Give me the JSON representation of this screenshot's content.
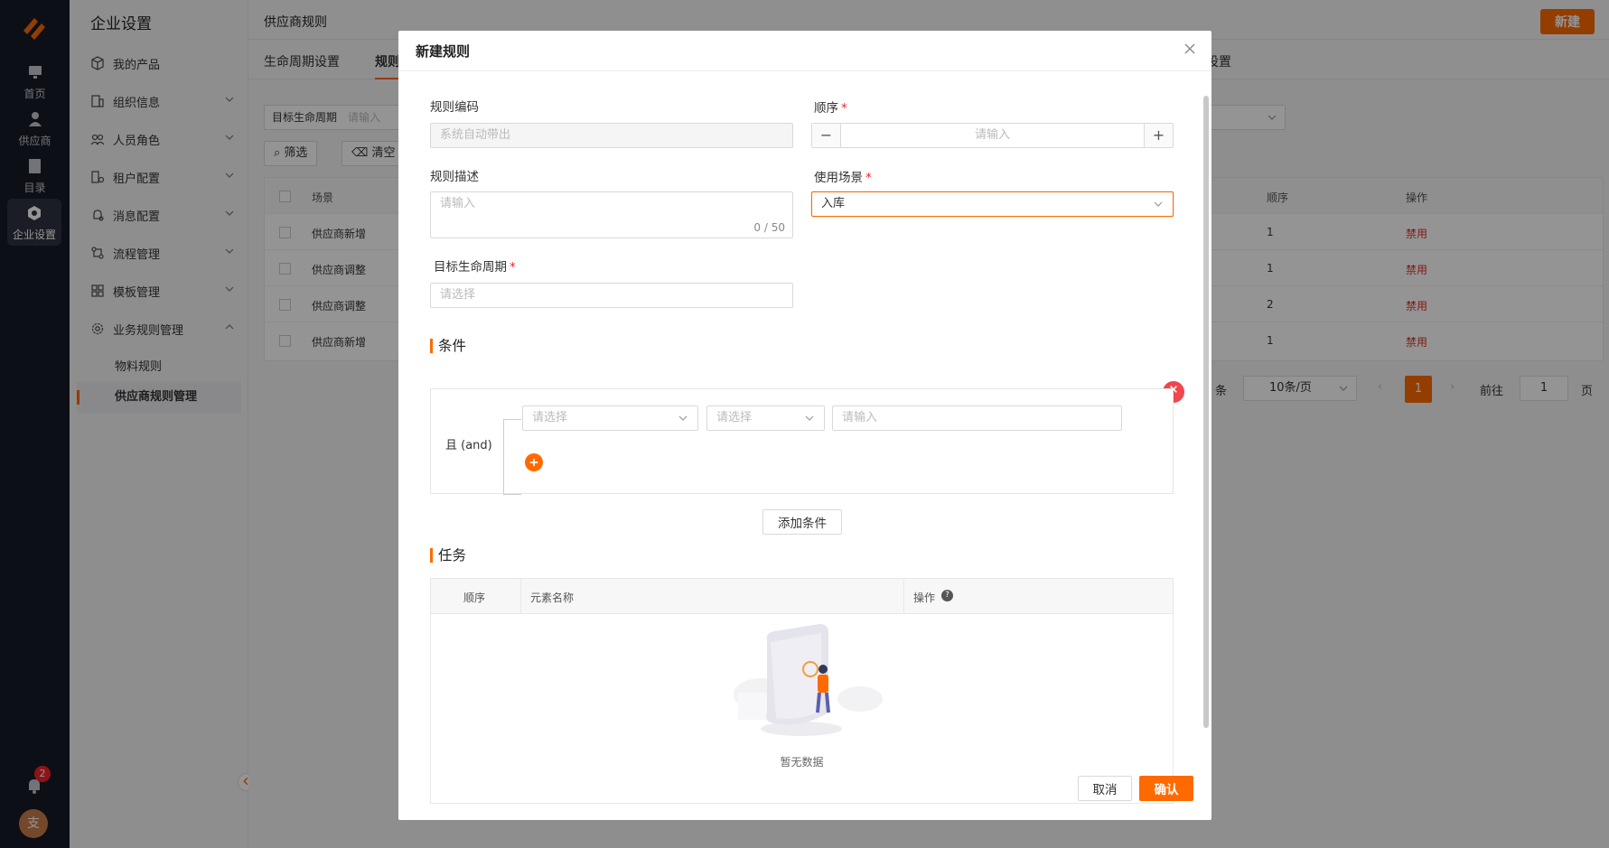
{
  "rail": {
    "items": [
      {
        "label": "首页"
      },
      {
        "label": "供应商"
      },
      {
        "label": "目录"
      },
      {
        "label": "企业设置"
      }
    ],
    "notification_count": "2",
    "avatar_text": "支"
  },
  "sidebar": {
    "title": "企业设置",
    "items": [
      {
        "label": "我的产品"
      },
      {
        "label": "组织信息"
      },
      {
        "label": "人员角色"
      },
      {
        "label": "租户配置"
      },
      {
        "label": "消息配置"
      },
      {
        "label": "流程管理"
      },
      {
        "label": "模板管理"
      },
      {
        "label": "业务规则管理"
      }
    ],
    "sub_items": [
      {
        "label": "物料规则"
      },
      {
        "label": "供应商规则管理"
      }
    ]
  },
  "main": {
    "page_title": "供应商规则",
    "new_button": "新建",
    "tabs": [
      {
        "label": "生命周期设置"
      },
      {
        "label": "规则"
      },
      {
        "label": "设置"
      }
    ],
    "filter_label": "目标生命周期",
    "filter_placeholder": "请输入",
    "filter_button": "筛选",
    "clear_button": "清空",
    "table": {
      "headers": {
        "scene": "场景",
        "order": "顺序",
        "action": "操作"
      },
      "rows": [
        {
          "scene": "供应商新增",
          "order": "1",
          "action": "禁用"
        },
        {
          "scene": "供应商调整",
          "order": "1",
          "action": "禁用"
        },
        {
          "scene": "供应商调整",
          "order": "2",
          "action": "禁用"
        },
        {
          "scene": "供应商新增",
          "order": "1",
          "action": "禁用"
        }
      ]
    },
    "pagination": {
      "total_suffix": "条",
      "page_size": "10条/页",
      "current_page": "1",
      "goto_label": "前往",
      "goto_value": "1",
      "page_suffix": "页"
    }
  },
  "modal": {
    "title": "新建规则",
    "code_label": "规则编码",
    "code_placeholder": "系统自动带出",
    "order_label": "顺序",
    "order_placeholder": "请输入",
    "desc_label": "规则描述",
    "desc_placeholder": "请输入",
    "desc_counter": "0 / 50",
    "scene_label": "使用场景",
    "scene_value": "入库",
    "lifecycle_label": "目标生命周期",
    "lifecycle_placeholder": "请选择",
    "conditions_title": "条件",
    "and_label": "且 (and)",
    "cond_select1_placeholder": "请选择",
    "cond_select2_placeholder": "请选择",
    "cond_input_placeholder": "请输入",
    "add_condition_button": "添加条件",
    "tasks_title": "任务",
    "task_table": {
      "headers": {
        "order": "顺序",
        "name": "元素名称",
        "action": "操作"
      },
      "empty_text": "暂无数据"
    },
    "cancel_button": "取消",
    "confirm_button": "确认"
  },
  "colors": {
    "accent": "#ff6a00",
    "danger": "#f5222d",
    "rail": "#171b26"
  }
}
